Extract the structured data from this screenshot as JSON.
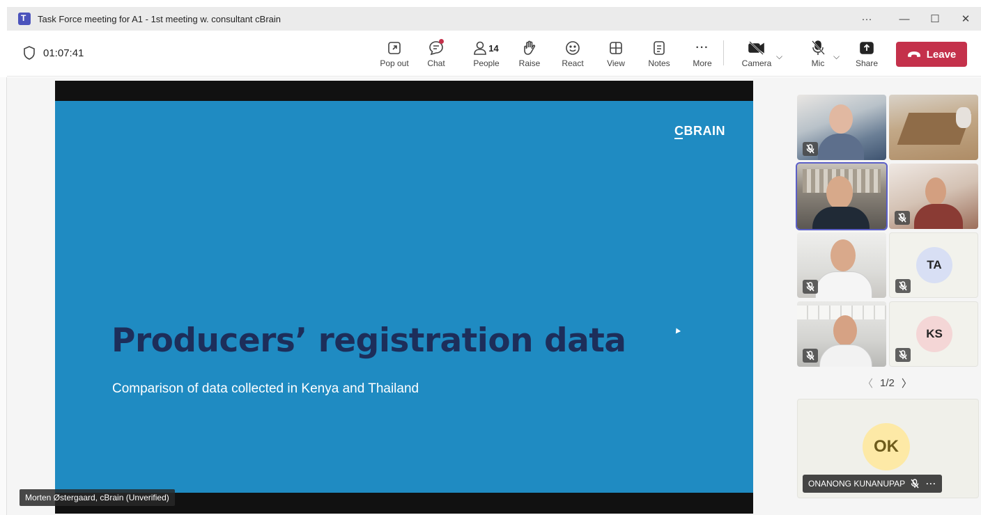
{
  "window": {
    "title": "Task Force meeting for A1 - 1st meeting w. consultant cBrain",
    "more_label": "···",
    "minimize_label": "—",
    "maximize_label": "☐",
    "close_label": "✕"
  },
  "toolbar": {
    "timer": "01:07:41",
    "buttons": {
      "popout": "Pop out",
      "chat": "Chat",
      "people": "People",
      "people_count": "14",
      "raise": "Raise",
      "react": "React",
      "view": "View",
      "notes": "Notes",
      "more": "More",
      "camera": "Camera",
      "mic": "Mic",
      "share": "Share",
      "leave": "Leave"
    },
    "more_glyph": "···",
    "chevron_glyph": "⌵"
  },
  "slide": {
    "brand": "CBRAIN",
    "title": "Producers’ registration data",
    "subtitle": "Comparison of data collected in Kenya and Thailand"
  },
  "presenter": {
    "label": "Morten Østergaard, cBrain (Unverified)"
  },
  "gallery": {
    "tiles": [
      {
        "initials": "TA",
        "avatar_color": "#d8dff4"
      },
      {
        "initials": "KS",
        "avatar_color": "#f4d6d6"
      }
    ],
    "pager": {
      "prev": "〈",
      "page": "1/2",
      "next": "〉"
    },
    "featured": {
      "initials": "OK",
      "name": "ONANONG KUNANUPAP",
      "more": "···"
    }
  },
  "colors": {
    "slide_bg": "#1f8bc2",
    "title_text": "#1d2e5a",
    "leave_button": "#c4314b",
    "selection_outline": "#5b5fc7"
  }
}
